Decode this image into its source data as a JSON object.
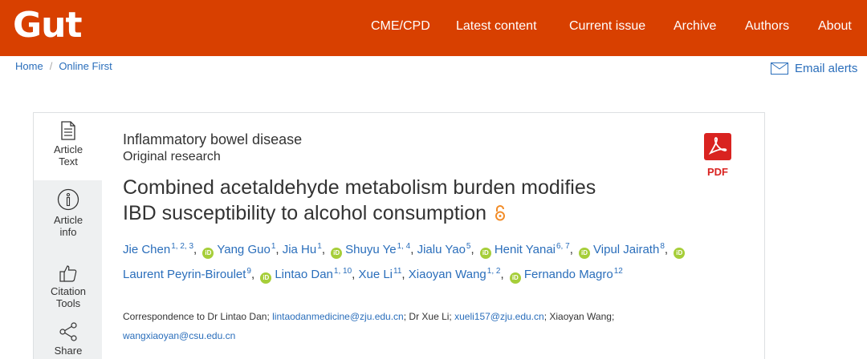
{
  "header": {
    "logo": "Gut",
    "nav": [
      "CME/CPD",
      "Latest content",
      "Current issue",
      "Archive",
      "Authors",
      "About"
    ]
  },
  "breadcrumb": {
    "home": "Home",
    "current": "Online First"
  },
  "email_alerts": "Email alerts",
  "side_tabs": [
    {
      "label_line1": "Article",
      "label_line2": "Text",
      "icon": "document-icon"
    },
    {
      "label_line1": "Article",
      "label_line2": "info",
      "icon": "info-icon"
    },
    {
      "label_line1": "Citation",
      "label_line2": "Tools",
      "icon": "thumbs-up-icon"
    },
    {
      "label_line1": "Share",
      "label_line2": "",
      "icon": "share-icon"
    }
  ],
  "article": {
    "topic": "Inflammatory bowel disease",
    "type": "Original research",
    "title_line1": "Combined acetaldehyde metabolism burden modifies",
    "title_line2": "IBD susceptibility to alcohol consumption",
    "open_access_icon": "open-access-icon",
    "pdf_label": "PDF",
    "authors": [
      {
        "name": "Jie Chen",
        "sup": "1, 2, 3",
        "orcid": false
      },
      {
        "name": "Yang Guo",
        "sup": "1",
        "orcid": true
      },
      {
        "name": "Jia Hu",
        "sup": "1",
        "orcid": false
      },
      {
        "name": "Shuyu Ye",
        "sup": "1, 4",
        "orcid": true
      },
      {
        "name": "Jialu Yao",
        "sup": "5",
        "orcid": false
      },
      {
        "name": "Henit Yanai",
        "sup": "6, 7",
        "orcid": true
      },
      {
        "name": "Vipul Jairath",
        "sup": "8",
        "orcid": true
      },
      {
        "name": "Laurent Peyrin-Biroulet",
        "sup": "9",
        "orcid": true
      },
      {
        "name": "Lintao Dan",
        "sup": "1, 10",
        "orcid": true
      },
      {
        "name": "Xue Li",
        "sup": "11",
        "orcid": false
      },
      {
        "name": "Xiaoyan Wang",
        "sup": "1, 2",
        "orcid": false
      },
      {
        "name": "Fernando Magro",
        "sup": "12",
        "orcid": true
      }
    ],
    "correspondence": {
      "prefix": "Correspondence to Dr Lintao Dan; ",
      "email1": "lintaodanmedicine@zju.edu.cn",
      "mid1": "; Dr Xue Li; ",
      "email2": "xueli157@zju.edu.cn",
      "mid2": "; Xiaoyan Wang; ",
      "email3": "wangxiaoyan@csu.edu.cn"
    }
  },
  "colors": {
    "brand": "#d84000",
    "link": "#2a6ebb",
    "orcid": "#a6ce39",
    "pdf": "#d92320",
    "open_access": "#f28c28"
  }
}
